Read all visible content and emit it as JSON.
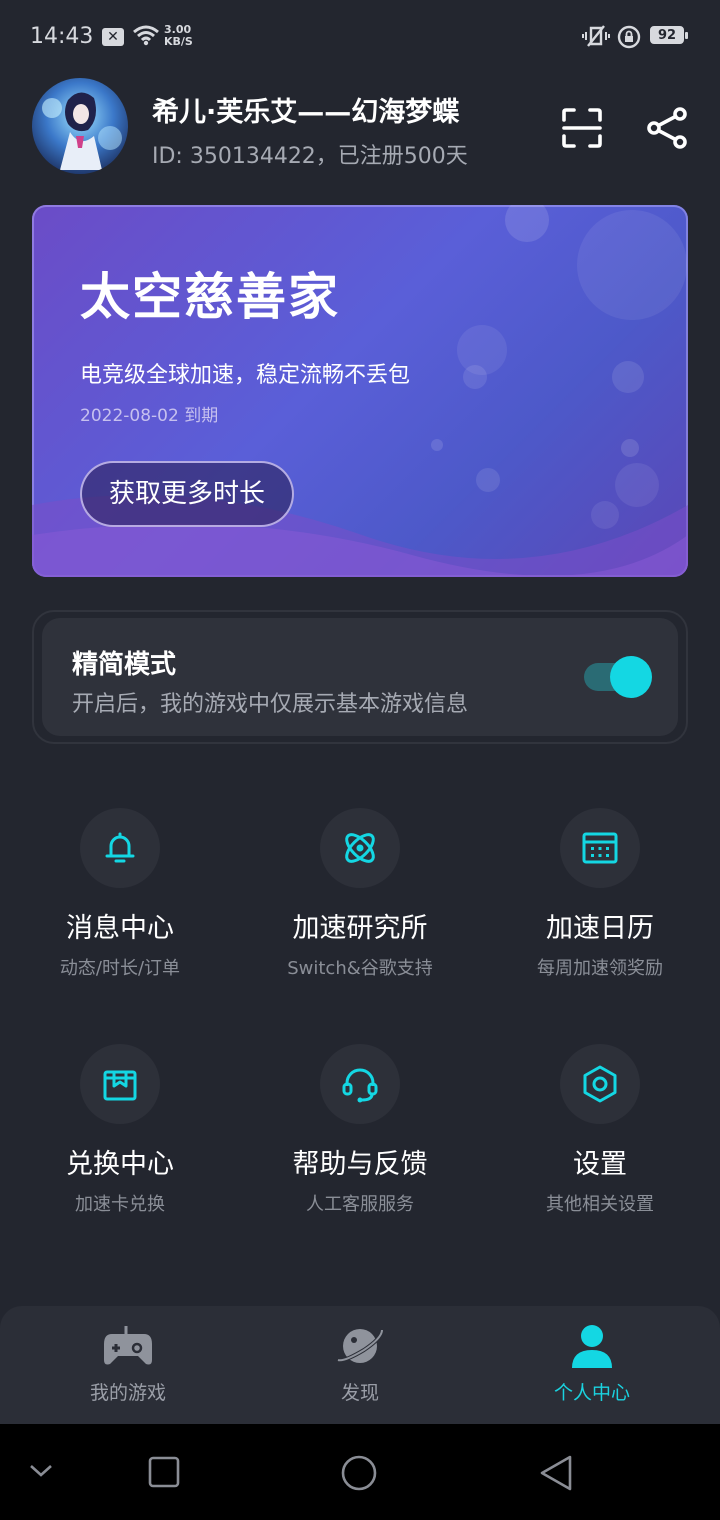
{
  "status_bar": {
    "time": "14:43",
    "speed_value": "3.00",
    "speed_unit": "KB/S",
    "battery": "92"
  },
  "profile": {
    "username": "希儿·芙乐艾——幻海梦蝶",
    "id_line": "ID: 350134422，已注册500天"
  },
  "banner": {
    "title": "太空慈善家",
    "subtitle": "电竞级全球加速，稳定流畅不丢包",
    "expiry": "2022-08-02 到期",
    "button": "获取更多时长"
  },
  "simple_mode": {
    "title": "精简模式",
    "description": "开启后，我的游戏中仅展示基本游戏信息",
    "enabled": true
  },
  "tiles": [
    {
      "label": "消息中心",
      "sub": "动态/时长/订单",
      "icon": "bell-icon"
    },
    {
      "label": "加速研究所",
      "sub": "Switch&谷歌支持",
      "icon": "atom-icon"
    },
    {
      "label": "加速日历",
      "sub": "每周加速领奖励",
      "icon": "calendar-icon"
    },
    {
      "label": "兑换中心",
      "sub": "加速卡兑换",
      "icon": "box-icon"
    },
    {
      "label": "帮助与反馈",
      "sub": "人工客服服务",
      "icon": "headset-icon"
    },
    {
      "label": "设置",
      "sub": "其他相关设置",
      "icon": "settings-icon"
    }
  ],
  "bottom_nav": [
    {
      "label": "我的游戏",
      "icon": "gamepad-icon",
      "active": false
    },
    {
      "label": "发现",
      "icon": "planet-icon",
      "active": false
    },
    {
      "label": "个人中心",
      "icon": "person-icon",
      "active": true
    }
  ],
  "colors": {
    "accent": "#14d7e3",
    "background": "#23262f",
    "card": "#2f323b"
  }
}
